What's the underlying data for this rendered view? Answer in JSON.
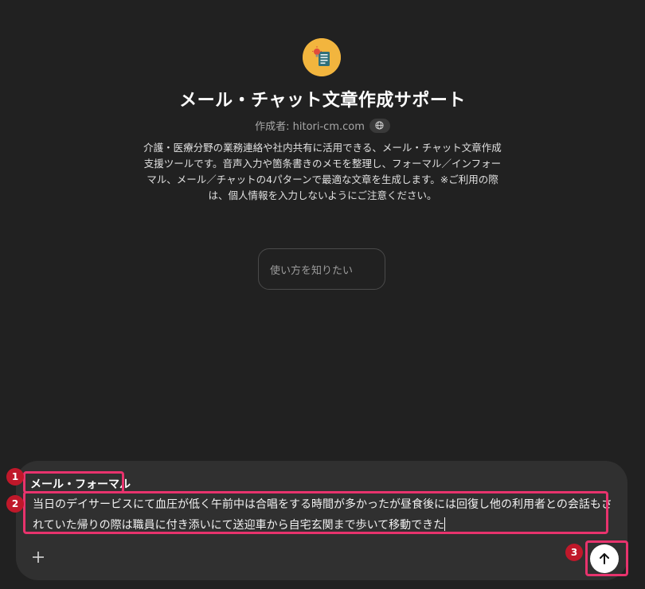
{
  "gpt": {
    "avatar_icon": "lightbulb-document-icon",
    "title": "メール・チャット文章作成サポート",
    "author": "作成者: hitori-cm.com",
    "globe_icon": "globe-icon",
    "description": "介護・医療分野の業務連絡や社内共有に活用できる、メール・チャット文章作成支援ツールです。音声入力や箇条書きのメモを整理し、フォーマル／インフォーマル、メール／チャットの4パターンで最適な文章を生成します。※ご利用の際は、個人情報を入力しないようにご注意ください。"
  },
  "conversation_starter": {
    "label": "使い方を知りたい"
  },
  "composer": {
    "line1": "メール・フォーマル",
    "line2_row1": "当日のデイサービスにて血圧が低く午前中は合唱をする時間が多かったが昼食後には回復し他の利用者との会話もさ",
    "line2_row2": "れていた帰りの際は職員に付き添いにて送迎車から自宅玄関まで歩いて移動できた",
    "plus_icon": "plus-icon",
    "send_icon": "arrow-up-icon"
  },
  "annotations": {
    "badge1": "1",
    "badge2": "2",
    "badge3": "3",
    "color": "#e8336d",
    "badge_color": "#c0182a"
  }
}
